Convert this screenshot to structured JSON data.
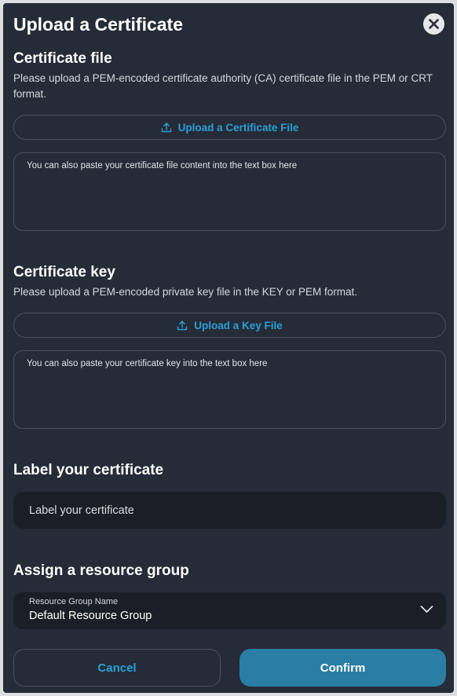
{
  "modal": {
    "title": "Upload a Certificate"
  },
  "certificate_file": {
    "heading": "Certificate file",
    "description": "Please upload a PEM-encoded certificate authority (CA) certificate file in the PEM or CRT format.",
    "upload_label": "Upload a Certificate File",
    "paste_placeholder": "You can also paste your certificate file content into the text box here"
  },
  "certificate_key": {
    "heading": "Certificate key",
    "description": "Please upload a PEM-encoded private key file in the KEY or PEM format.",
    "upload_label": "Upload a Key File",
    "paste_placeholder": "You can also paste your certificate key into the text box here"
  },
  "label_section": {
    "heading": "Label your certificate",
    "input_placeholder": "Label your certificate"
  },
  "resource_group": {
    "heading": "Assign a resource group",
    "field_label": "Resource Group Name",
    "selected_value": "Default Resource Group"
  },
  "actions": {
    "cancel_label": "Cancel",
    "confirm_label": "Confirm"
  },
  "colors": {
    "background": "#252b37",
    "accent": "#2a9fd6",
    "confirm": "#2a7da5"
  },
  "icons": {
    "close": "close-icon",
    "upload": "upload-icon",
    "dropdown": "chevron-down-icon"
  }
}
